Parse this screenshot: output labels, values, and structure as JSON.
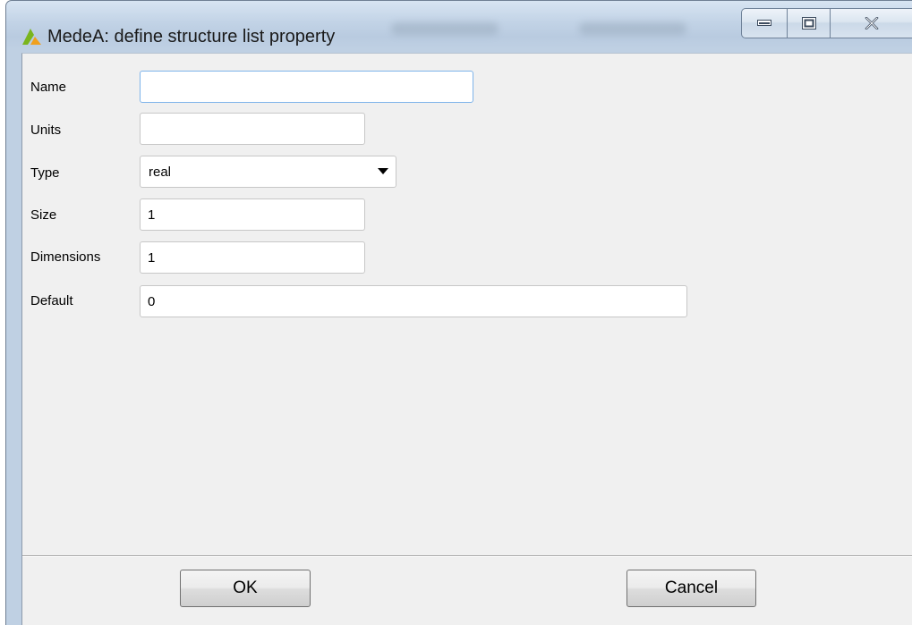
{
  "window": {
    "title": "MedeA: define structure list property",
    "icon": "medea-logo-icon"
  },
  "caption": {
    "minimize_icon": "minimize-icon",
    "maximize_icon": "maximize-icon",
    "close_icon": "close-icon"
  },
  "form": {
    "name": {
      "label": "Name",
      "value": ""
    },
    "units": {
      "label": "Units",
      "value": ""
    },
    "type": {
      "label": "Type",
      "value": "real"
    },
    "size": {
      "label": "Size",
      "value": "1"
    },
    "dimensions": {
      "label": "Dimensions",
      "value": "1"
    },
    "default": {
      "label": "Default",
      "value": "0"
    }
  },
  "buttons": {
    "ok_label": "OK",
    "cancel_label": "Cancel"
  },
  "colors": {
    "title_bar": "#c2d3e6",
    "client_background": "#f0f0f0",
    "focus_border": "#7eb4ea",
    "logo_green": "#7ab51d",
    "logo_orange": "#f0a01e"
  }
}
